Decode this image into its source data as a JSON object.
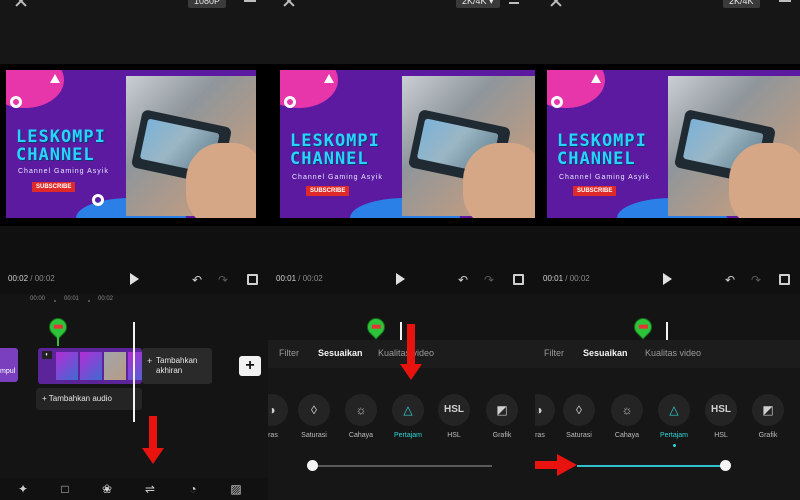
{
  "screens": [
    {
      "resolution": "1080P",
      "time": {
        "current": "00:02",
        "sep": "/",
        "total": "00:02"
      },
      "ruler": [
        "00:00",
        "00:01",
        "00:02"
      ],
      "clip_left_label": "mpul",
      "tail_label": "Tambahkan akhiran",
      "audio_label": "+ Tambahkan audio",
      "add_symbol": "+"
    },
    {
      "resolution": "2K/4K ▾",
      "time": {
        "current": "00:01",
        "sep": "/",
        "total": "00:02"
      },
      "tabs": [
        "Filter",
        "Sesuaikan",
        "Kualitas video"
      ],
      "items": [
        "tras",
        "Saturasi",
        "Cahaya",
        "Pertajam",
        "HSL",
        "Grafik"
      ]
    },
    {
      "resolution": "2K/4K",
      "time": {
        "current": "00:01",
        "sep": "/",
        "total": "00:02"
      },
      "tabs": [
        "Filter",
        "Sesuaikan",
        "Kualitas video"
      ],
      "items": [
        "tras",
        "Saturasi",
        "Cahaya",
        "Pertajam",
        "HSL",
        "Grafik"
      ]
    }
  ],
  "thumbnail": {
    "brand_line1": "LESKOMPI",
    "brand_line2": "CHANNEL",
    "tagline": "Channel Gaming Asyik",
    "subscribe": "SUBSCRIBE"
  },
  "adjust": {
    "selected_item": "Pertajam",
    "slider_value_panel2": 0,
    "slider_value_panel3": 1
  },
  "colors": {
    "accent": "#2fd6d6",
    "arrow": "#e8130f",
    "pin": "#2ec43a"
  },
  "icons": [
    "close-icon",
    "menu-icon",
    "export-icon",
    "play-icon",
    "undo-icon",
    "redo-icon",
    "fullscreen-icon"
  ]
}
